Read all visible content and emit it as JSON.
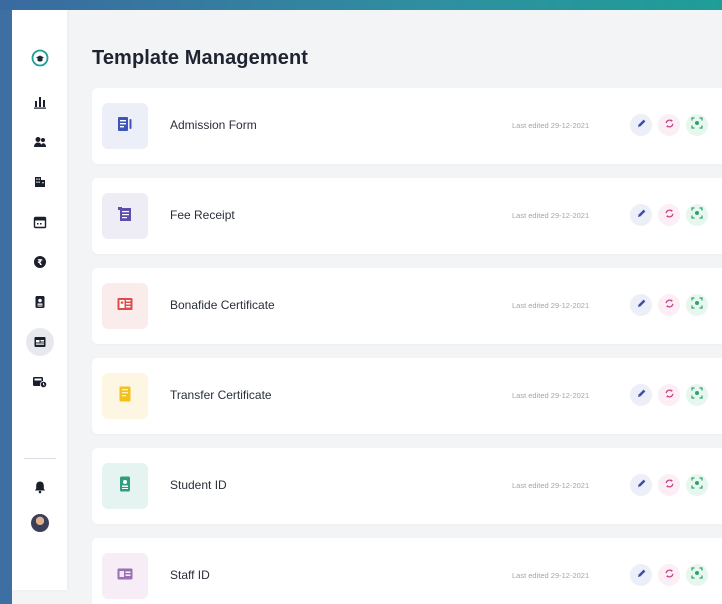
{
  "header": {
    "title": "Template Management"
  },
  "sidebar": {
    "items": [
      {
        "icon": "logo-icon"
      },
      {
        "icon": "analytics-icon"
      },
      {
        "icon": "users-icon"
      },
      {
        "icon": "building-icon"
      },
      {
        "icon": "calendar-icon"
      },
      {
        "icon": "finance-icon"
      },
      {
        "icon": "id-badge-icon"
      },
      {
        "icon": "templates-icon",
        "active": true
      },
      {
        "icon": "transport-icon"
      }
    ],
    "bottom": [
      {
        "icon": "bell-icon"
      },
      {
        "icon": "profile-avatar"
      }
    ]
  },
  "templates": [
    {
      "name": "Admission Form",
      "last_edited": "Last edited 29-12-2021",
      "icon": "form-icon",
      "tile_bg": "#eceef8",
      "tile_fg": "#3d55b8"
    },
    {
      "name": "Fee Receipt",
      "last_edited": "Last edited 29-12-2021",
      "icon": "receipt-icon",
      "tile_bg": "#eeedf6",
      "tile_fg": "#5a4ea8"
    },
    {
      "name": "Bonafide Certificate",
      "last_edited": "Last edited 29-12-2021",
      "icon": "certificate-icon",
      "tile_bg": "#fbecec",
      "tile_fg": "#e24b4b"
    },
    {
      "name": "Transfer Certificate",
      "last_edited": "Last edited 29-12-2021",
      "icon": "document-icon",
      "tile_bg": "#fdf6e3",
      "tile_fg": "#f2c21b"
    },
    {
      "name": "Student ID",
      "last_edited": "Last edited 29-12-2021",
      "icon": "student-id-icon",
      "tile_bg": "#e6f4f1",
      "tile_fg": "#2e9e7f"
    },
    {
      "name": "Staff ID",
      "last_edited": "Last edited 29-12-2021",
      "icon": "staff-id-icon",
      "tile_bg": "#f6edf7",
      "tile_fg": "#9b6fb5"
    }
  ],
  "actions": {
    "edit_icon": "edit-icon",
    "sync_icon": "sync-icon",
    "view_icon": "view-icon"
  },
  "colors": {
    "accent": "#1f9e97",
    "edit": "#3d4fa8",
    "sync": "#c24a8a",
    "view": "#2fa36b"
  }
}
